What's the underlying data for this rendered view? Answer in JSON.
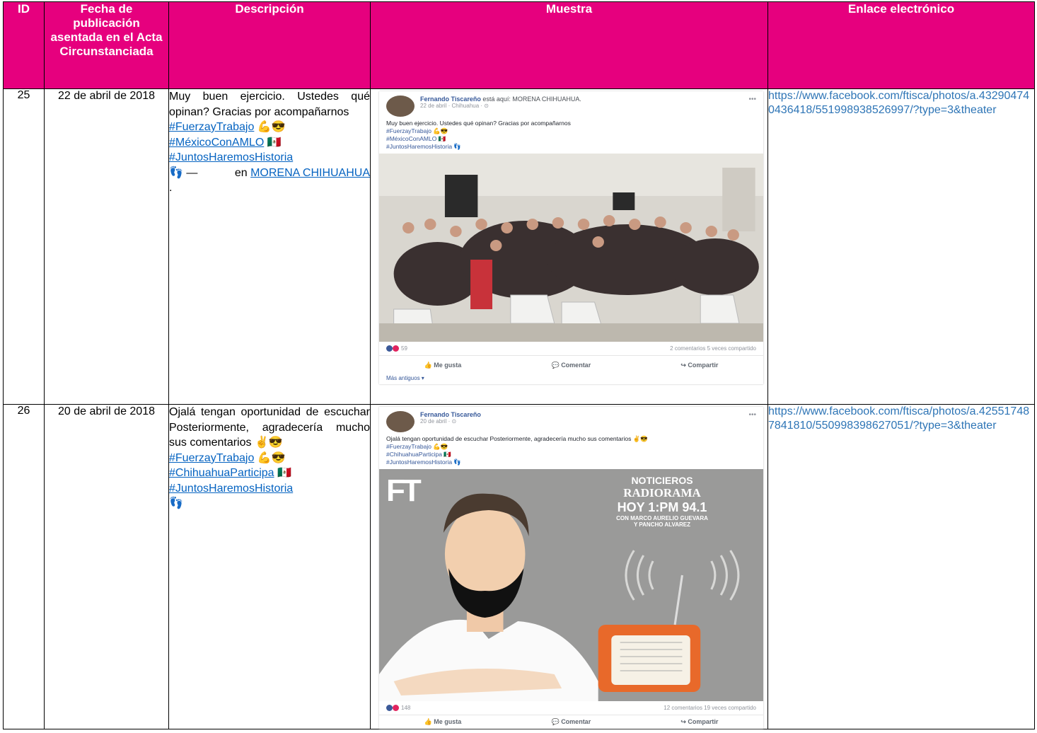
{
  "headers": {
    "id": "ID",
    "fecha": "Fecha de publicación asentada en el Acta Circunstanciada",
    "descripcion": "Descripción",
    "muestra": "Muestra",
    "enlace": "Enlace electrónico"
  },
  "rows": [
    {
      "id": "25",
      "fecha": "22 de abril de 2018",
      "desc_text": "Muy buen ejercicio. Ustedes qué opinan? Gracias por acompañarnos",
      "tags": [
        "#FuerzayTrabajo",
        "#MéxicoConAMLO",
        "#JuntosHaremosHistoria"
      ],
      "tag_suffix_1": "💪😎",
      "tag_suffix_2": "🇲🇽",
      "tag_suffix_3": "👣 —",
      "en_label": "en",
      "place_link": "MORENA CHIHUAHUA",
      "place_end": ".",
      "enlace": "https://www.facebook.com/ftisca/photos/a.432904740436418/551998938526997/?type=3&theater",
      "sample": {
        "author": "Fernando Tiscareño",
        "author_rest": "está aquí: MORENA CHIHUAHUA.",
        "meta": "22 de abril · Chihuahua · ⊙",
        "text": "Muy buen ejercicio. Ustedes qué opinan? Gracias por acompañarnos",
        "tags": [
          "#FuerzayTrabajo 💪😎",
          "#MéxicoConAMLO 🇲🇽",
          "#JuntosHaremosHistoria 👣"
        ],
        "reactions": "59",
        "stats": "2 comentarios  5 veces compartido",
        "like": "Me gusta",
        "comment": "Comentar",
        "share": "Compartir",
        "older": "Más antiguos ▾"
      }
    },
    {
      "id": "26",
      "fecha": "20 de abril de 2018",
      "desc_text": "Ojalá tengan oportunidad de escuchar Posteriormente, agradecería mucho sus comentarios ✌😎",
      "tags": [
        "#FuerzayTrabajo",
        "#ChihuahuaParticipa",
        "#JuntosHaremosHistoria"
      ],
      "tag_suffix_1": "💪😎",
      "tag_suffix_2": "🇲🇽",
      "tag_suffix_3": "👣",
      "enlace": "https://www.facebook.com/ftisca/photos/a.425517487841810/550998398627051/?type=3&theater",
      "sample": {
        "author": "Fernando Tiscareño",
        "meta": "20 de abril · ⊙",
        "text": "Ojalá tengan oportunidad de escuchar Posteriormente, agradecería mucho sus comentarios ✌😎",
        "tags": [
          "#FuerzayTrabajo 💪😎",
          "#ChihuahuaParticipa 🇲🇽",
          "#JuntosHaremosHistoria 👣"
        ],
        "poster_logo": "FT",
        "poster_line1": "NOTICIEROS",
        "poster_line2": "RADIORAMA",
        "poster_line3": "HOY 1:PM 94.1",
        "poster_line4": "CON MARCO AURELIO GUEVARA",
        "poster_line5": "Y PANCHO ALVAREZ",
        "reactions": "148",
        "stats": "12 comentarios  19 veces compartido",
        "like": "Me gusta",
        "comment": "Comentar",
        "share": "Compartir"
      }
    }
  ],
  "colors": {
    "header_bg": "#e6007e",
    "link": "#0563c1"
  }
}
